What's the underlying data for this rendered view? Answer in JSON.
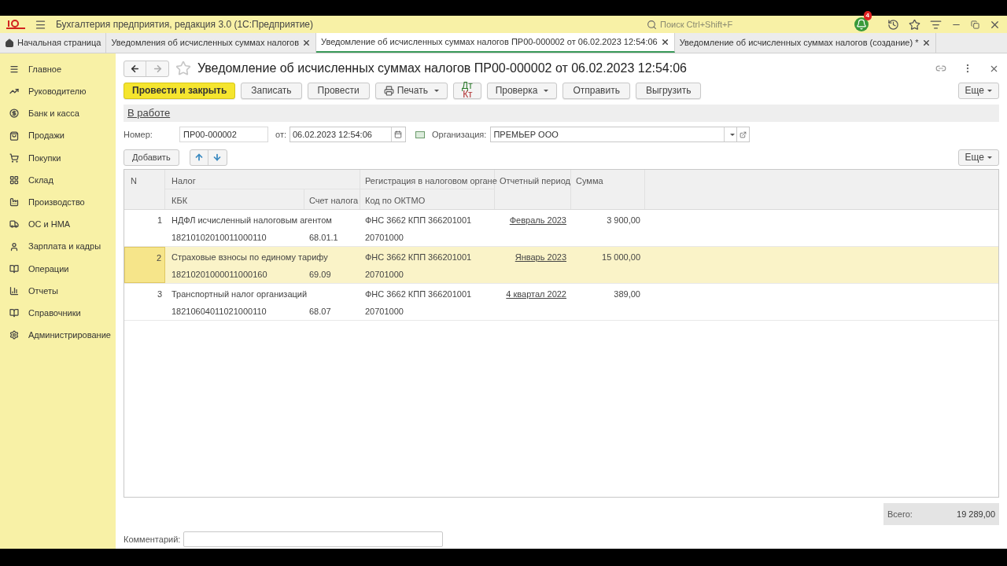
{
  "app": {
    "title": "Бухгалтерия предприятия, редакция 3.0  (1С:Предприятие)",
    "search_placeholder": "Поиск Ctrl+Shift+F",
    "notification_count": "4"
  },
  "tabs": [
    {
      "label": "Начальная страница",
      "kind": "home",
      "selected": false
    },
    {
      "label": "Уведомления об исчисленных суммах налогов",
      "kind": "doc",
      "selected": false
    },
    {
      "label": "Уведомление об исчисленных суммах налогов ПР00-000002 от 06.02.2023 12:54:06",
      "kind": "doc",
      "selected": true
    },
    {
      "label": "Уведомление об исчисленных суммах налогов (создание) *",
      "kind": "doc",
      "selected": false
    }
  ],
  "sidebar": {
    "items": [
      {
        "label": "Главное"
      },
      {
        "label": "Руководителю"
      },
      {
        "label": "Банк и касса"
      },
      {
        "label": "Продажи"
      },
      {
        "label": "Покупки"
      },
      {
        "label": "Склад"
      },
      {
        "label": "Производство"
      },
      {
        "label": "ОС и НМА"
      },
      {
        "label": "Зарплата и кадры"
      },
      {
        "label": "Операции"
      },
      {
        "label": "Отчеты"
      },
      {
        "label": "Справочники"
      },
      {
        "label": "Администрирование"
      }
    ]
  },
  "document": {
    "title": "Уведомление об исчисленных суммах налогов ПР00-000002 от 06.02.2023 12:54:06",
    "toolbar": [
      {
        "label": "Провести и закрыть",
        "kind": "primary"
      },
      {
        "label": "Записать",
        "kind": "plain"
      },
      {
        "label": "Провести",
        "kind": "plain"
      },
      {
        "label": "Печать",
        "kind": "print"
      },
      {
        "label": "Дт",
        "label2": "Кт",
        "kind": "dtkt"
      },
      {
        "label": "Проверка",
        "kind": "dropdown"
      },
      {
        "label": "Отправить",
        "kind": "plain"
      },
      {
        "label": "Выгрузить",
        "kind": "plain"
      }
    ],
    "more_button": "Еще",
    "status_link": "В работе",
    "number_label": "Номер:",
    "number_value": "ПР00-000002",
    "date_label": "от:",
    "date_value": "06.02.2023 12:54:06",
    "org_label": "Организация:",
    "org_value": "ПРЕМЬЕР ООО",
    "add_button": "Добавить",
    "table_more_button": "Еще",
    "table": {
      "columns": {
        "n": "N",
        "tax": "Налог",
        "kbk": "КБК",
        "account": "Счет налога",
        "registration": "Регистрация в налоговом органе",
        "oktmo": "Код по ОКТМО",
        "period": "Отчетный период",
        "sum": "Сумма"
      },
      "rows": [
        {
          "n": "1",
          "tax": "НДФЛ исчисленный налоговым агентом",
          "kbk": "18210102010011000110",
          "account": "68.01.1",
          "registration": "ФНС 3662 КПП 366201001",
          "oktmo": "20701000",
          "period": "Февраль 2023",
          "sum": "3 900,00",
          "selected": false
        },
        {
          "n": "2",
          "tax": "Страховые взносы по единому тарифу",
          "kbk": "18210201000011000160",
          "account": "69.09",
          "registration": "ФНС 3662 КПП 366201001",
          "oktmo": "20701000",
          "period": "Январь 2023",
          "sum": "15 000,00",
          "selected": true
        },
        {
          "n": "3",
          "tax": "Транспортный налог организаций",
          "kbk": "18210604011021000110",
          "account": "68.07",
          "registration": "ФНС 3662 КПП 366201001",
          "oktmo": "20701000",
          "period": "4 квартал 2022",
          "sum": "389,00",
          "selected": false
        }
      ]
    },
    "total_label": "Всего:",
    "total_value": "19 289,00",
    "comment_label": "Комментарий:"
  }
}
